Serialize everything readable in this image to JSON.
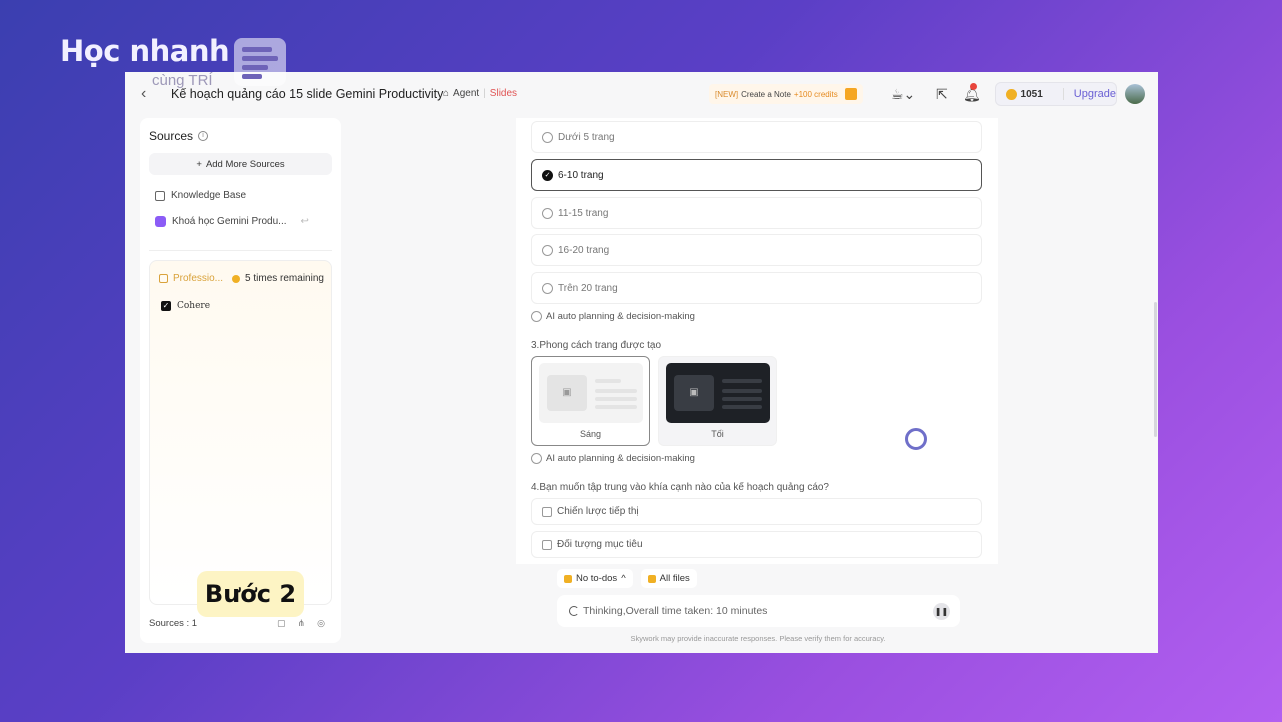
{
  "watermark": {
    "brand": "Học nhanh",
    "tagline": "cùng TRÍ"
  },
  "topbar": {
    "title": "Kế hoạch quảng cáo 15 slide Gemini Productivity",
    "agent_label": "Agent",
    "slides_label": "Slides",
    "promo_new": "[NEW]",
    "promo_text": "Create a Note",
    "promo_credits": "+100 credits",
    "credit_count": "1051",
    "upgrade_label": "Upgrade"
  },
  "sidebar": {
    "title": "Sources",
    "add_sources": "Add More Sources",
    "knowledge_base": "Knowledge Base",
    "course": "Khoá học Gemini Produ...",
    "pro_name": "Professio...",
    "pro_remaining": "5 times remaining",
    "model": "Cohere",
    "sources_count": "Sources : 1"
  },
  "step_badge": "Bước 2",
  "main": {
    "page_options": [
      {
        "label": "Dưới 5 trang",
        "selected": false
      },
      {
        "label": "6-10 trang",
        "selected": true
      },
      {
        "label": "11-15 trang",
        "selected": false
      },
      {
        "label": "16-20 trang",
        "selected": false
      },
      {
        "label": "Trên 20 trang",
        "selected": false
      }
    ],
    "auto_label": "AI auto planning & decision-making",
    "q3": "3.Phong cách trang được tạo",
    "style_light": "Sáng",
    "style_dark": "Tối",
    "q4": "4.Bạn muốn tập trung vào khía cạnh nào của kế hoạch quảng cáo?",
    "focus_options": [
      "Chiến lược tiếp thị",
      "Đối tượng mục tiêu"
    ]
  },
  "bottom": {
    "todos": "No to-dos",
    "files": "All files",
    "thinking": "Thinking,Overall time taken: 10 minutes",
    "disclaimer": "Skywork may provide inaccurate responses. Please verify them for accuracy."
  },
  "colors": {
    "accent": "#6a5fd4",
    "slides": "#e05454",
    "badge": "#fdf4c4"
  }
}
